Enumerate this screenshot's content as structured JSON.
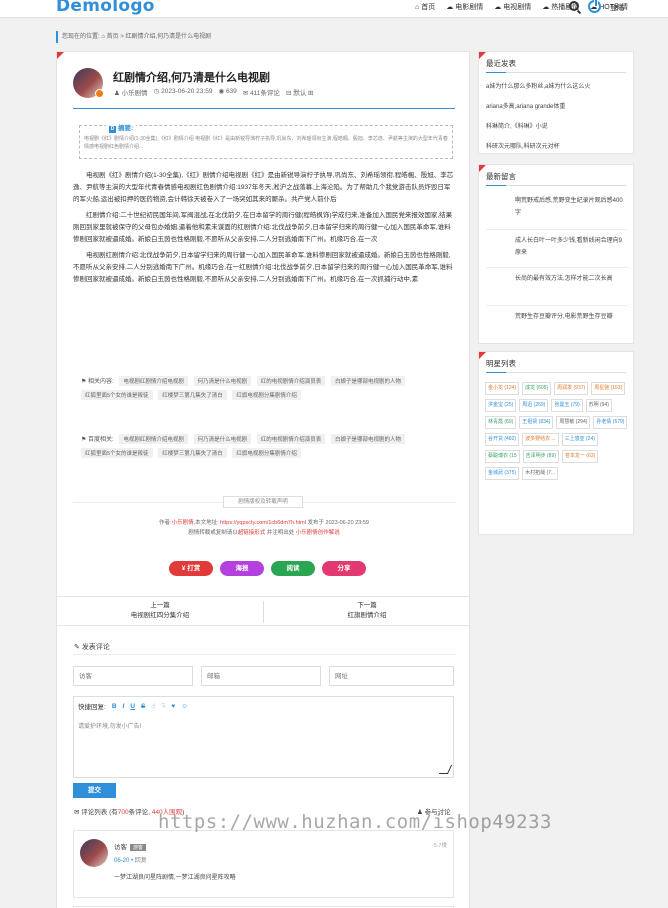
{
  "header": {
    "logo": "Demologo",
    "nav": [
      "首页",
      "电影剧情",
      "电视剧情",
      "热播剧情",
      "HOT剧情"
    ],
    "login": "登陆"
  },
  "breadcrumb": {
    "prefix": "您现在的位置:",
    "home": "首页",
    "sep": ">",
    "current": "红剧情介绍,何乃清是什么电视剧"
  },
  "article": {
    "title": "红剧情介绍,何乃清是什么电视剧",
    "author": "小乐剧情",
    "date": "2023-06-20 23:59",
    "views": "639",
    "comments": "411条评论",
    "font": "默认",
    "summary_label": "摘要:",
    "summary": "电视剧《红》剧情介绍(1-30全集),《红》剧情介绍 电视剧《红》是由新锐导演柠子执导,巩尚东、刘希瑶领衔主演,程皓楓、殷旭、李芯逸、尹航等主演的大型年代青春情感电视剧红色剧情介绍...",
    "paragraphs": [
      "电视剧《红》剧情介绍(1-30全集),《红》剧情介绍电视剧《红》是由新锐导演柠子执导,巩尚东、刘希瑶领衔,程皓楓、殷旭、李芯逸、尹航等主演的大型年代青春情感电视剧红色剧情介绍:1937年冬天,淞沪之战落幕,上海沦陷。为了帮助几个我党游击队员炸毁日军的军火船,运出被扣押的医药物资,会计韩徐天被卷入了一场突如其来的厮杀。共产党人前仆后",
      "红剧情介绍:二十世纪初民国年间,军阀混战,在北伐前夕,在日本留学的周行健(程皓枫饰)学成归来,准备加入国民党来报效国家,结果刚回到家里就被保守的父母包办婚姻,逼着他和素未谋面的红剧情介绍:北伐战争前夕,日本留学归来的周行健一心加入国民革命军,谁料惨剧回家就被逼成婚。新娘白玉茵也性格刚毅,不愿听从父亲安排,二人分别逃婚南下广州。机缘巧合,在一次",
      "电视剧红剧情介绍:北伐战争前夕,日本留学归来的周行健一心加入国民革命军,谁料惨剧回家就被逼成婚。新娘白玉茵也性格刚毅,不愿听从父亲安排,二人分别逃婚南下广州。机缘巧合,在一红剧情介绍:北伐战争前夕,日本留学归来的周行健一心加入国民革命军,谁料惨剧回家就被逼成婚。新娘白玉茵也性格刚毅,不愿听从父亲安排,二人分别逃婚南下广州。机缘巧合,在一次抓捕行动中,素"
    ],
    "related_label": "相关内容:",
    "related": [
      "电视剧红剧情介绍电视剧",
      "何乃清是什么电视剧",
      "红的电视剧情介绍演员表",
      "白娘子是哪部电视剧的人物",
      "红狐里面5个女的谁是叛徒",
      "红楼梦三第几集失了清白",
      "红旗电视剧分集剧情介绍"
    ],
    "baidu_label": "百度相关:",
    "baidu": [
      "电视剧红剧情介绍电视剧",
      "何乃清是什么电视剧",
      "红的电视剧情介绍演员表",
      "白娘子是哪部电视剧的人物",
      "红狐里面5个女的谁是叛徒",
      "红楼梦三第几集失了清白",
      "红旗电视剧分集剧情介绍"
    ],
    "copyright_title": "剧情版权及转载声明",
    "source_line1_a": "作者:",
    "source_author": "小乐剧情",
    "source_line1_b": ",本文地址:",
    "source_url": "https://yqpscty.com/1cb6dm7h.html",
    "source_line1_c": "发布于 2023-06-20 23:59",
    "source_line2_a": "剧情转载或复制请以",
    "source_link": "超链接形式",
    "source_line2_b": "并注明出处",
    "source_site": "小乐剧情创作解说",
    "buttons": {
      "tip": "¥ 打赏",
      "poster": "海报",
      "read": "阅读",
      "share": "分享"
    },
    "prev_label": "上一篇",
    "prev_title": "电视剧红四分集介绍",
    "next_label": "下一篇",
    "next_title": "红旗剧情介绍"
  },
  "comment_form": {
    "title": "发表评论",
    "name_ph": "访客",
    "email_ph": "邮箱",
    "url_ph": "网址",
    "quick_reply": "快捷回复:",
    "textarea_ph": "请爱护环境,勿发小广告!",
    "submit": "提交"
  },
  "comment_list": {
    "label_a": "评论列表",
    "label_b": "(有",
    "count": "700",
    "label_c": "条评论,",
    "views": "440人围观",
    "label_d": ")",
    "join": "参与讨论"
  },
  "comment": {
    "name": "访客",
    "badge": "游客",
    "date": "06-20",
    "reply": "回复",
    "floor": "-5.7楼",
    "text": "一梦江湖良问星阵剧情,一梦江湖良问星阵攻略"
  },
  "sidebar": {
    "recent_title": "最近发表",
    "recent": [
      "a妹为什么那么多粉丝,a妹为什么这么火",
      "ariana多高,ariana grande体重",
      "科琳简介,《科琳》小说",
      "科研次元哪队,科研次元对杯"
    ],
    "messages_title": "最新留言",
    "messages": [
      "啊荒野戒后感,荒野变生纪录片观后感400字",
      "成人长白叶一叶多少钱,看新线闲合理向9原来",
      "长尚的最有效方法,怎样才能二次长高",
      "荒野生存豆瓣评分,电影荒野生存豆瓣"
    ],
    "stars_title": "明星列表",
    "stars": [
      {
        "name": "金小龙",
        "count": "(124)",
        "color": "#e07a2a"
      },
      {
        "name": "成龙",
        "count": "(605)",
        "color": "#3aa36b"
      },
      {
        "name": "周润发",
        "count": "(937)",
        "color": "#e07a2a"
      },
      {
        "name": "周星驰",
        "count": "(153)",
        "color": "#e07a2a"
      },
      {
        "name": "洪金宝",
        "count": "(25)",
        "color": "#2f8fd8"
      },
      {
        "name": "周迅",
        "count": "(269)",
        "color": "#2f8fd8"
      },
      {
        "name": "张曼玉",
        "count": "(79)",
        "color": "#2f8fd8"
      },
      {
        "name": "苏明",
        "count": "(94)",
        "color": "#666"
      },
      {
        "name": "林青霞",
        "count": "(69)",
        "color": "#3aa36b"
      },
      {
        "name": "王祖贤",
        "count": "(834)",
        "color": "#2f8fd8"
      },
      {
        "name": "周慧敏",
        "count": "(294)",
        "color": "#666"
      },
      {
        "name": "孙老倩",
        "count": "(579)",
        "color": "#2f8fd8"
      },
      {
        "name": "谷开贷",
        "count": "(482)",
        "color": "#2f8fd8"
      },
      {
        "name": "波多野结衣",
        "count": "...",
        "color": "#e07a2a"
      },
      {
        "name": "三上悠亚",
        "count": "(24)",
        "color": "#2f8fd8"
      },
      {
        "name": "蔡聪博衣",
        "count": "(15",
        "color": "#3aa36b"
      },
      {
        "name": "吉泽明步",
        "count": "(89)",
        "color": "#3aa36b"
      },
      {
        "name": "苍本龙一",
        "count": "(63)",
        "color": "#e07a2a"
      },
      {
        "name": "金城武",
        "count": "(375)",
        "color": "#2f8fd8"
      },
      {
        "name": "木村拓哉",
        "count": "(7...",
        "color": "#666"
      }
    ]
  },
  "watermark": "https://www.huzhan.com/ishop49233",
  "colors": {
    "accent": "#2f8fd8",
    "red": "#e23a3a",
    "pink": "#e23a70",
    "purple": "#b440e0",
    "green": "#2aa653"
  }
}
